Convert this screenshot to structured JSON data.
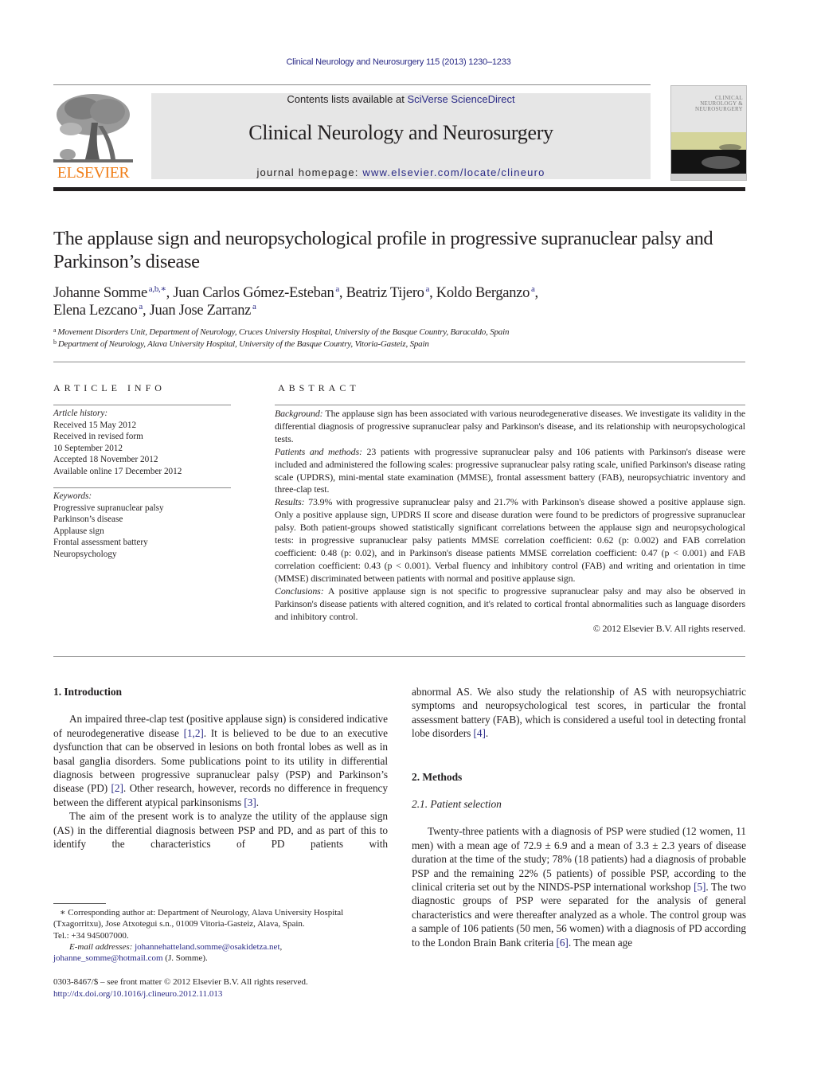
{
  "header": {
    "journal_reference": "Clinical Neurology and Neurosurgery 115 (2013) 1230–1233",
    "publisher_logo_label": "ELSEVIER",
    "contents_prefix": "Contents lists available at ",
    "contents_link": "SciVerse ScienceDirect",
    "journal_title": "Clinical Neurology and Neurosurgery",
    "homepage_prefix": "journal homepage: ",
    "homepage_link": "www.elsevier.com/locate/clineuro",
    "cover_title_lines": [
      "CLINICAL",
      "NEUROLOGY &",
      "NEUROSURGERY"
    ],
    "colors": {
      "link": "#2a2a86",
      "elsevier_orange": "#f07f1a",
      "banner_bg": "#e6e6e6"
    }
  },
  "article": {
    "title": "The applause sign and neuropsychological profile in progressive supranuclear palsy and Parkinson’s disease",
    "authors": [
      {
        "name": "Johanne Somme",
        "sup": "a,b,∗"
      },
      {
        "name": "Juan Carlos Gómez-Esteban",
        "sup": "a"
      },
      {
        "name": "Beatriz Tijero",
        "sup": "a"
      },
      {
        "name": "Koldo Berganzo",
        "sup": "a"
      },
      {
        "name": "Elena Lezcano",
        "sup": "a"
      },
      {
        "name": "Juan Jose Zarranz",
        "sup": "a"
      }
    ],
    "affiliations": [
      {
        "mark": "a",
        "text": "Movement Disorders Unit, Department of Neurology, Cruces University Hospital, University of the Basque Country, Baracaldo, Spain"
      },
      {
        "mark": "b",
        "text": "Department of Neurology, Alava University Hospital, University of the Basque Country, Vitoria-Gasteiz, Spain"
      }
    ]
  },
  "article_info": {
    "heading": "ARTICLE INFO",
    "history_label": "Article history:",
    "history": [
      "Received 15 May 2012",
      "Received in revised form",
      "10 September 2012",
      "Accepted 18 November 2012",
      "Available online 17 December 2012"
    ],
    "keywords_label": "Keywords:",
    "keywords": [
      "Progressive supranuclear palsy",
      "Parkinson’s disease",
      "Applause sign",
      "Frontal assessment battery",
      "Neuropsychology"
    ]
  },
  "abstract": {
    "heading": "ABSTRACT",
    "sections": [
      {
        "label": "Background:",
        "text": " The applause sign has been associated with various neurodegenerative diseases. We investigate its validity in the differential diagnosis of progressive supranuclear palsy and Parkinson's disease, and its relationship with neuropsychological tests."
      },
      {
        "label": "Patients and methods:",
        "text": " 23 patients with progressive supranuclear palsy and 106 patients with Parkinson's disease were included and administered the following scales: progressive supranuclear palsy rating scale, unified Parkinson's disease rating scale (UPDRS), mini-mental state examination (MMSE), frontal assessment battery (FAB), neuropsychiatric inventory and three-clap test."
      },
      {
        "label": "Results:",
        "text": " 73.9% with progressive supranuclear palsy and 21.7% with Parkinson's disease showed a positive applause sign. Only a positive applause sign, UPDRS II score and disease duration were found to be predictors of progressive supranuclear palsy. Both patient-groups showed statistically significant correlations between the applause sign and neuropsychological tests: in progressive supranuclear palsy patients MMSE correlation coefficient: 0.62 (p: 0.002) and FAB correlation coefficient: 0.48 (p: 0.02), and in Parkinson's disease patients MMSE correlation coefficient: 0.47 (p < 0.001) and FAB correlation coefficient: 0.43 (p < 0.001). Verbal fluency and inhibitory control (FAB) and writing and orientation in time (MMSE) discriminated between patients with normal and positive applause sign."
      },
      {
        "label": "Conclusions:",
        "text": " A positive applause sign is not specific to progressive supranuclear palsy and may also be observed in Parkinson's disease patients with altered cognition, and it's related to cortical frontal abnormalities such as language disorders and inhibitory control."
      }
    ],
    "copyright": "© 2012 Elsevier B.V. All rights reserved."
  },
  "body": {
    "intro_heading": "1.  Introduction",
    "intro_p1_a": "An impaired three-clap test (positive applause sign) is considered indicative of neurodegenerative disease ",
    "intro_p1_ref1": "[1,2]",
    "intro_p1_b": ". It is believed to be due to an executive dysfunction that can be observed in lesions on both frontal lobes as well as in basal ganglia disorders. Some publications point to its utility in differential diagnosis between progressive supranuclear palsy (PSP) and Parkinson’s disease (PD) ",
    "intro_p1_ref2": "[2]",
    "intro_p1_c": ". Other research, however, records no difference in frequency between the different atypical parkinsonisms ",
    "intro_p1_ref3": "[3]",
    "intro_p1_d": ".",
    "intro_p2_a": "The aim of the present work is to analyze the utility of the applause sign (AS) in the differential diagnosis between PSP and PD, and as part of this to identify the characteristics of PD patients with abnormal AS. We also study the relationship of AS with neuropsychiatric symptoms and neuropsychological test scores, in particular the frontal assessment battery (FAB), which is considered a useful tool in detecting frontal lobe disorders ",
    "intro_p2_col1": "The aim of the present work is to analyze the utility of the applause sign (AS) in the differential diagnosis between PSP and PD, and as part of this to identify the characteristics of PD patients with",
    "intro_p2_col2": "abnormal AS. We also study the relationship of AS with neuropsychiatric symptoms and neuropsychological test scores, in particular the frontal assessment battery (FAB), which is considered a useful tool in detecting frontal lobe disorders ",
    "intro_p2_ref": "[4]",
    "intro_p2_end": ".",
    "methods_heading": "2.  Methods",
    "subsection_heading": "2.1.  Patient selection",
    "methods_p1_a": "Twenty-three patients with a diagnosis of PSP were studied (12 women, 11 men) with a mean age of 72.9 ± 6.9 and a mean of 3.3 ± 2.3 years of disease duration at the time of the study; 78% (18 patients) had a diagnosis of probable PSP and the remaining 22% (5 patients) of possible PSP, according to the clinical criteria set out by the NINDS-PSP international workshop ",
    "methods_p1_ref5": "[5]",
    "methods_p1_b": ". The two diagnostic groups of PSP were separated for the analysis of general characteristics and were thereafter analyzed as a whole. The control group was a sample of 106 patients (50 men, 56 women) with a diagnosis of PD according to the London Brain Bank criteria ",
    "methods_p1_ref6": "[6]",
    "methods_p1_c": ". The mean age"
  },
  "footnotes": {
    "corresponding": "∗  Corresponding author at: Department of Neurology, Alava University Hospital (Txagorritxu), Jose Atxotegui s.n., 01009 Vitoria-Gasteiz, Alava, Spain.",
    "tel": "Tel.: +34 945007000.",
    "email_label": "E-mail addresses:",
    "email1": "johannehatteland.somme@osakidetza.net",
    "email2": "johanne_somme@hotmail.com",
    "email_suffix": " (J. Somme).",
    "issn_line": "0303-8467/$ – see front matter © 2012 Elsevier B.V. All rights reserved.",
    "doi": "http://dx.doi.org/10.1016/j.clineuro.2012.11.013"
  }
}
